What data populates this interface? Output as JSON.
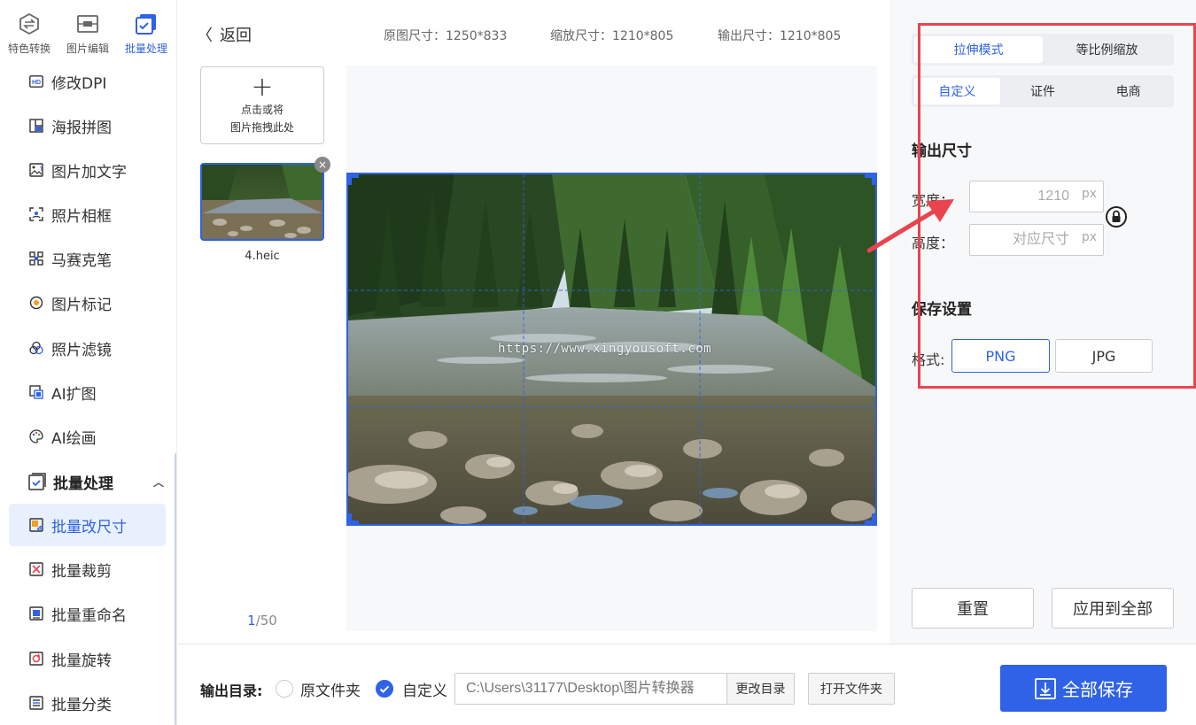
{
  "sidebar": {
    "top_tabs": [
      {
        "label": "特色转换",
        "icon": "swap-icon"
      },
      {
        "label": "图片编辑",
        "icon": "image-edit-icon"
      },
      {
        "label": "批量处理",
        "icon": "batch-icon",
        "active": true
      }
    ],
    "items": [
      {
        "label": "修改DPI",
        "icon": "hd-icon"
      },
      {
        "label": "海报拼图",
        "icon": "collage-icon"
      },
      {
        "label": "图片加文字",
        "icon": "image-text-icon"
      },
      {
        "label": "照片相框",
        "icon": "frame-icon"
      },
      {
        "label": "马赛克笔",
        "icon": "mosaic-icon"
      },
      {
        "label": "图片标记",
        "icon": "mark-icon"
      },
      {
        "label": "照片滤镜",
        "icon": "filter-icon"
      },
      {
        "label": "AI扩图",
        "icon": "ai-expand-icon"
      },
      {
        "label": "AI绘画",
        "icon": "palette-icon"
      }
    ],
    "group": {
      "label": "批量处理",
      "icon": "batch-icon"
    },
    "sub_items": [
      {
        "label": "批量改尺寸",
        "icon": "resize-icon",
        "active": true
      },
      {
        "label": "批量裁剪",
        "icon": "crop-icon"
      },
      {
        "label": "批量重命名",
        "icon": "rename-icon"
      },
      {
        "label": "批量旋转",
        "icon": "rotate-icon"
      },
      {
        "label": "批量分类",
        "icon": "classify-icon"
      }
    ]
  },
  "header": {
    "back_label": "返回",
    "original_size": "原图尺寸：1250*833",
    "scaled_size": "缩放尺寸：1210*805",
    "output_size": "输出尺寸：1210*805"
  },
  "thumbnails": {
    "upload_line1": "点击或将",
    "upload_line2": "图片拖拽此处",
    "file_name": "4.heic",
    "page_current": "1",
    "page_total": "/50"
  },
  "preview": {
    "watermark": "https://www.xingyousoft.com"
  },
  "settings": {
    "mode_tabs": [
      "拉伸模式",
      "等比例缩放"
    ],
    "sub_tabs": [
      "自定义",
      "证件",
      "电商"
    ],
    "output_size_title": "输出尺寸",
    "width_label": "宽度：",
    "width_placeholder": "1210",
    "height_label": "高度：",
    "height_placeholder": "对应尺寸",
    "unit": "px",
    "save_title": "保存设置",
    "format_label": "格式:",
    "formats": [
      "PNG",
      "JPG"
    ],
    "reset_label": "重置",
    "apply_all_label": "应用到全部"
  },
  "bottom": {
    "output_dir_label": "输出目录:",
    "option_original": "原文件夹",
    "option_custom": "自定义",
    "path_placeholder": "C:\\Users\\31177\\Desktop\\图片转换器",
    "change_dir_label": "更改目录",
    "open_folder_label": "打开文件夹",
    "save_all_label": "全部保存"
  },
  "colors": {
    "accent": "#2f62e6",
    "highlight": "#e8454f"
  }
}
